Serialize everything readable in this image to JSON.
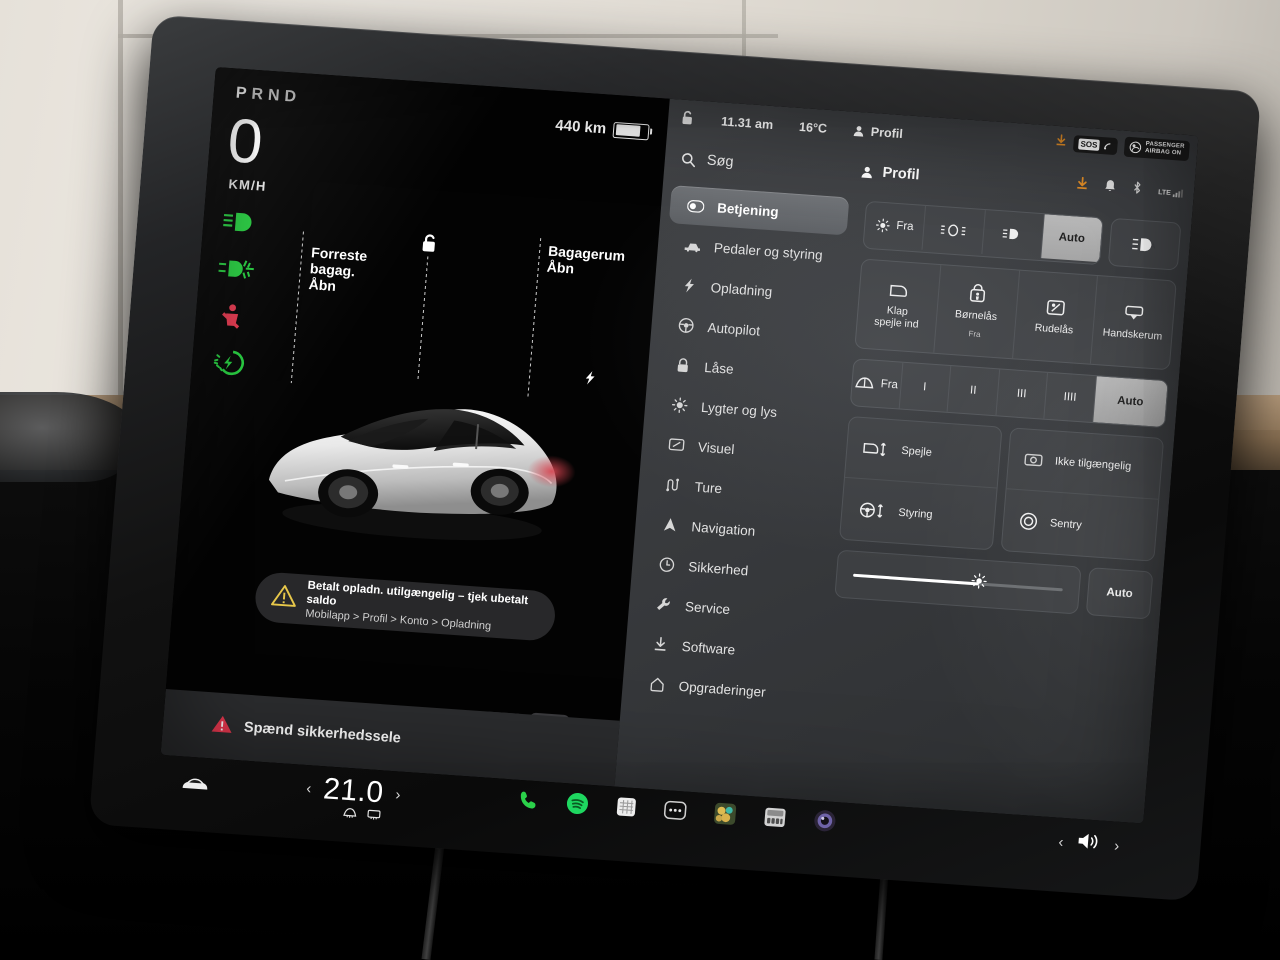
{
  "drive_panel": {
    "gear_indicator": "PRND",
    "gear_active": "P",
    "speed": "0",
    "speed_unit": "KM/H",
    "range": "440 km",
    "indicators": [
      {
        "name": "low-beam-headlight-icon",
        "color": "#25d13f"
      },
      {
        "name": "front-fog-light-icon",
        "color": "#25d13f"
      },
      {
        "name": "seatbelt-warning-icon",
        "color": "#e8384f"
      },
      {
        "name": "ready-to-drive-icon",
        "color": "#25d13f"
      }
    ],
    "callouts": [
      {
        "name": "front-trunk-callout",
        "line1": "Forreste",
        "line2": "bagag.",
        "line3": "Åbn"
      },
      {
        "name": "rear-trunk-callout",
        "line1": "Bagagerum",
        "line2": "Åbn",
        "line3": ""
      }
    ],
    "lock_status": "unlocked",
    "toast": {
      "line1": "Betalt opladn. utilgængelig – tjek ubetalt saldo",
      "line2": "Mobilapp > Profil > Konto > Opladning"
    },
    "seatbelt_alert": "Spænd sikkerhedssele"
  },
  "status_bar": {
    "time": "11.31 am",
    "temperature": "16°C",
    "profile": "Profil",
    "sos_label": "SOS",
    "airbag_line1": "PASSENGER",
    "airbag_line2": "AIRBAG ON",
    "download_color": "#e08c26"
  },
  "sub_bar": {
    "search_placeholder": "Søg",
    "profile": "Profil",
    "icons": [
      "download-icon",
      "bell-icon",
      "bluetooth-icon",
      "lte-signal-icon"
    ],
    "lte_label": "LTE"
  },
  "menu": {
    "items": [
      {
        "label": "Betjening",
        "icon": "toggle-icon",
        "active": true
      },
      {
        "label": "Pedaler og styring",
        "icon": "pedals-icon",
        "active": false
      },
      {
        "label": "Opladning",
        "icon": "bolt-icon",
        "active": false
      },
      {
        "label": "Autopilot",
        "icon": "steering-wheel-icon",
        "active": false
      },
      {
        "label": "Låse",
        "icon": "lock-icon",
        "active": false
      },
      {
        "label": "Lygter og lys",
        "icon": "sun-icon",
        "active": false
      },
      {
        "label": "Visuel",
        "icon": "display-icon",
        "active": false
      },
      {
        "label": "Ture",
        "icon": "trips-icon",
        "active": false
      },
      {
        "label": "Navigation",
        "icon": "navigation-arrow-icon",
        "active": false
      },
      {
        "label": "Sikkerhed",
        "icon": "shield-clock-icon",
        "active": false
      },
      {
        "label": "Service",
        "icon": "wrench-icon",
        "active": false
      },
      {
        "label": "Software",
        "icon": "download-arrow-icon",
        "active": false
      },
      {
        "label": "Opgraderinger",
        "icon": "upgrade-icon",
        "active": false
      }
    ]
  },
  "controls": {
    "lights_row": {
      "cells": [
        {
          "label": "Fra",
          "icon": "sun-small-icon",
          "on": false
        },
        {
          "label": "",
          "icon": "parking-lights-icon",
          "on": false
        },
        {
          "label": "",
          "icon": "low-beam-icon",
          "on": false
        },
        {
          "label": "Auto",
          "icon": "",
          "on": true
        }
      ],
      "side_button": {
        "label": "",
        "icon": "auto-high-beam-icon"
      }
    },
    "quick_grid": [
      {
        "label": "Klap\nspejle ind",
        "sub": "",
        "icon": "mirror-fold-icon"
      },
      {
        "label": "Børnelås",
        "sub": "Fra",
        "icon": "child-lock-icon"
      },
      {
        "label": "Rudelås",
        "sub": "",
        "icon": "window-lock-icon"
      },
      {
        "label": "Handskerum",
        "sub": "",
        "icon": "glovebox-icon"
      }
    ],
    "wiper_row": {
      "cells": [
        {
          "label": "Fra",
          "icon": "wiper-icon",
          "on": false
        },
        {
          "label": "I",
          "icon": "",
          "on": false
        },
        {
          "label": "II",
          "icon": "",
          "on": false
        },
        {
          "label": "III",
          "icon": "",
          "on": false
        },
        {
          "label": "IIII",
          "icon": "",
          "on": false
        },
        {
          "label": "Auto",
          "icon": "",
          "on": true
        }
      ]
    },
    "adjust_cards": [
      {
        "label": "Spejle",
        "icon": "mirror-adjust-icon"
      },
      {
        "label": "Styring",
        "icon": "steering-adjust-icon"
      },
      {
        "label": "Ikke tilgængelig",
        "icon": "dashcam-icon"
      },
      {
        "label": "Sentry",
        "icon": "sentry-icon"
      }
    ],
    "brightness": {
      "value": 60,
      "icon": "brightness-icon",
      "auto_label": "Auto"
    }
  },
  "dock": {
    "car_icon": "car-icon",
    "temperature": "21.0",
    "prev_label": "‹",
    "next_label": "›",
    "defrost_icons": [
      "front-defrost-icon",
      "rear-defrost-icon"
    ],
    "apps": [
      {
        "name": "phone-app-icon",
        "color": "#2bd14a"
      },
      {
        "name": "spotify-app-icon",
        "color": "#1ed760"
      },
      {
        "name": "calendar-app-icon",
        "color": "#e6e6e6"
      },
      {
        "name": "more-apps-icon",
        "color": "#cfcfcf"
      },
      {
        "name": "arcade-app-icon",
        "color": "#c8a24a"
      },
      {
        "name": "toybox-app-icon",
        "color": "#b5b5b5"
      },
      {
        "name": "camera-app-icon",
        "color": "#9a8fd8"
      }
    ],
    "volume_icon": "volume-icon"
  }
}
